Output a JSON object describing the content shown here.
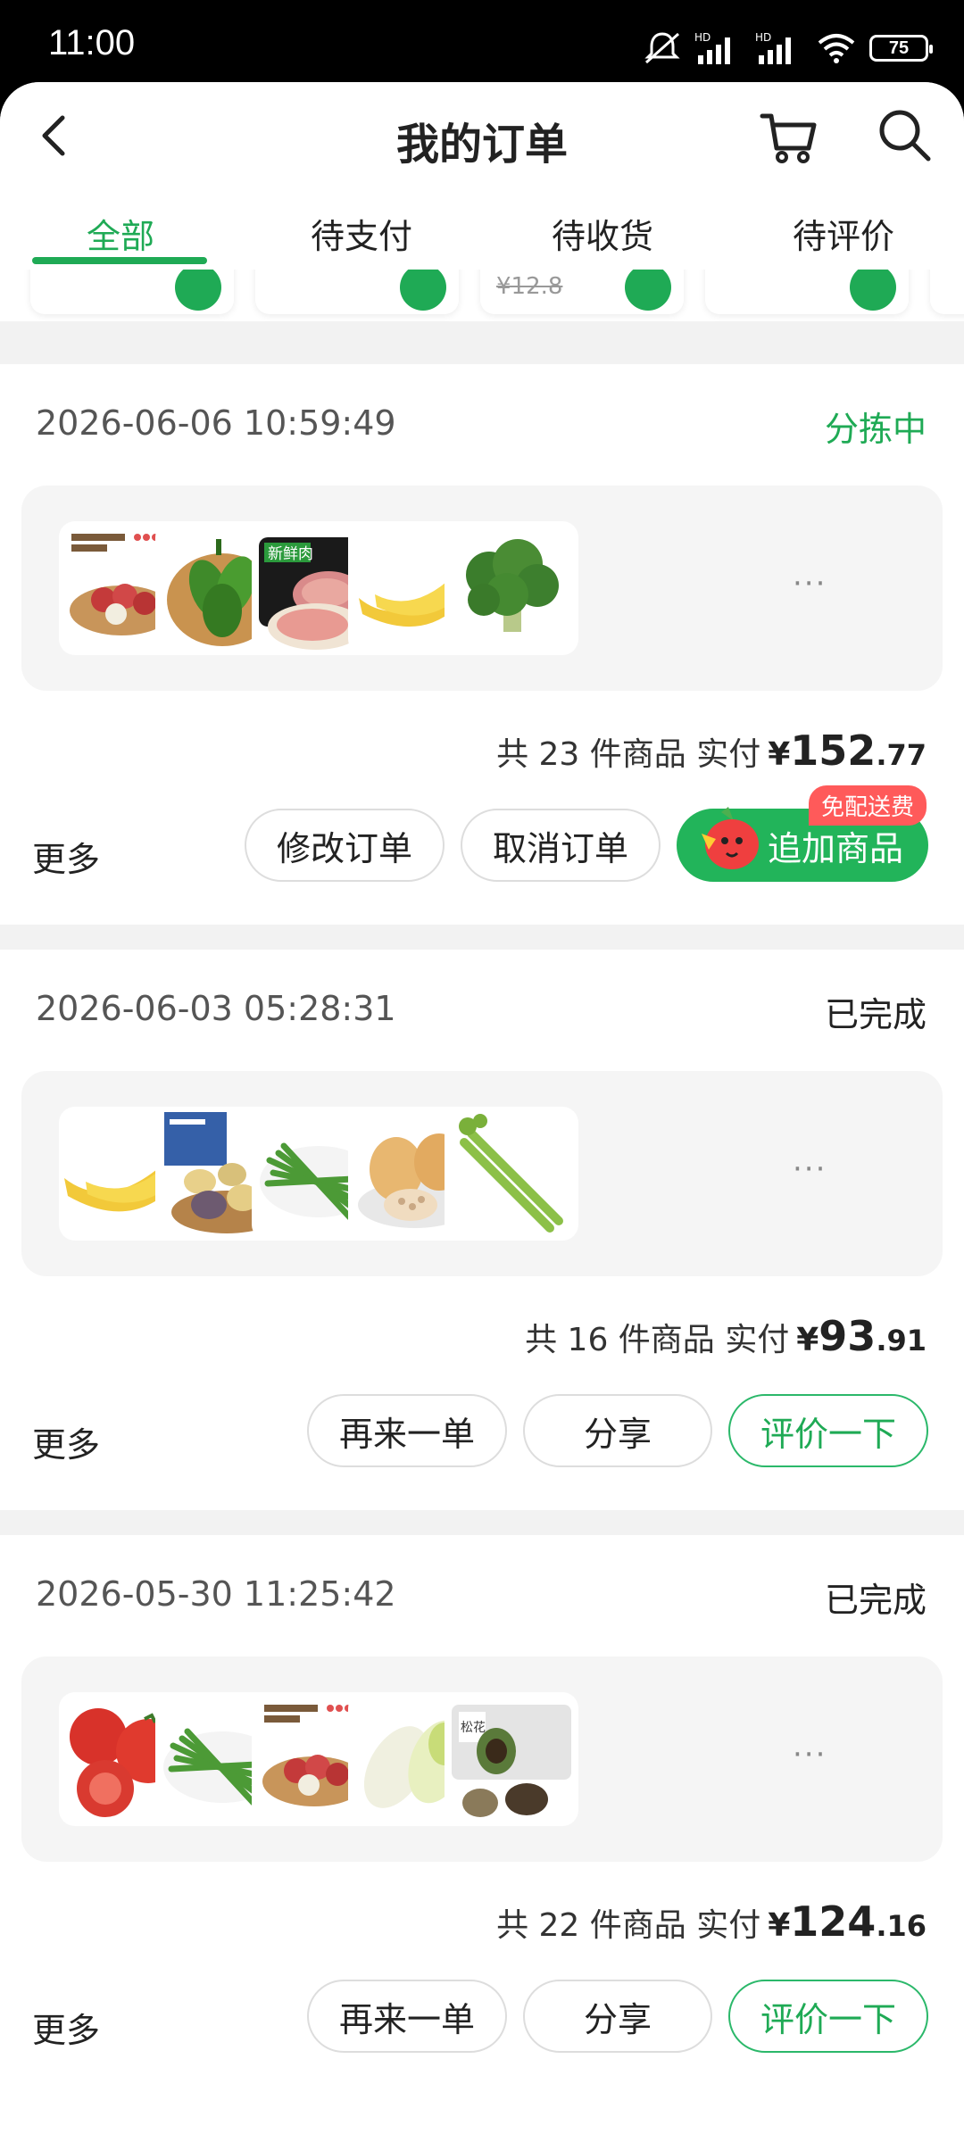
{
  "status_bar": {
    "time": "11:00",
    "battery": "75"
  },
  "header": {
    "title": "我的订单"
  },
  "tabs": [
    {
      "label": "全部",
      "active": true
    },
    {
      "label": "待支付",
      "active": false
    },
    {
      "label": "待收货",
      "active": false
    },
    {
      "label": "待评价",
      "active": false
    }
  ],
  "peek": {
    "old_price": "¥12.8"
  },
  "orders": [
    {
      "datetime": "2026-06-06 10:59:49",
      "status": "分拣中",
      "summary_prefix": "共 23 件商品  实付",
      "currency": "¥",
      "amount_int": "152",
      "amount_dec": ".77",
      "more": "更多",
      "buttons": [
        "修改订单",
        "取消订单",
        "追加商品"
      ],
      "badge": "免配送费",
      "more_dots": "···"
    },
    {
      "datetime": "2026-06-03 05:28:31",
      "status": "已完成",
      "summary_prefix": "共 16 件商品  实付",
      "currency": "¥",
      "amount_int": "93",
      "amount_dec": ".91",
      "more": "更多",
      "buttons": [
        "再来一单",
        "分享",
        "评价一下"
      ],
      "more_dots": "···"
    },
    {
      "datetime": "2026-05-30 11:25:42",
      "status": "已完成",
      "summary_prefix": "共 22 件商品  实付",
      "currency": "¥",
      "amount_int": "124",
      "amount_dec": ".16",
      "more": "更多",
      "buttons": [
        "再来一单",
        "分享",
        "评价一下"
      ],
      "more_dots": "···"
    }
  ],
  "colors": {
    "accent": "#1faa55",
    "badge": "#ff5a5a"
  },
  "icons": [
    "back-icon",
    "cart-icon",
    "search-icon",
    "menu-icon",
    "home-icon",
    "nav-back-icon"
  ]
}
